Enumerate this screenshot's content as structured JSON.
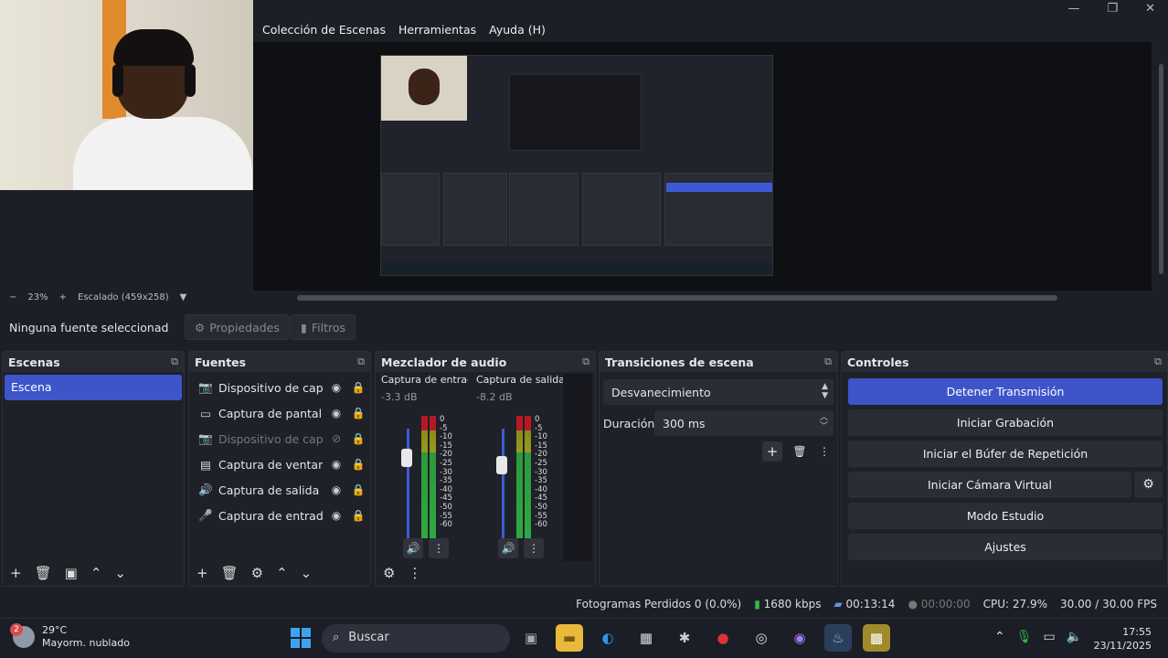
{
  "menu": [
    "Colección de Escenas",
    "Herramientas",
    "Ayuda (H)"
  ],
  "window_controls": [
    "—",
    "❐",
    "✕"
  ],
  "preview": {
    "zoom_minus": "−",
    "zoom": "23%",
    "zoom_plus": "+",
    "scale_label": "Escalado (459x258)"
  },
  "source_toolbar": {
    "no_source": "Ninguna fuente seleccionad",
    "properties": "Propiedades",
    "filters": "Filtros"
  },
  "scenes": {
    "title": "Escenas",
    "items": [
      "Escena"
    ]
  },
  "sources": {
    "title": "Fuentes",
    "items": [
      {
        "label": "Dispositivo de captu",
        "icon": "camera-icon",
        "visible": true
      },
      {
        "label": "Captura de pantalla :",
        "icon": "monitor-icon",
        "visible": true
      },
      {
        "label": "Dispositivo de captu",
        "icon": "camera-icon",
        "visible": false
      },
      {
        "label": "Captura de ventana",
        "icon": "window-icon",
        "visible": true
      },
      {
        "label": "Captura de salida de",
        "icon": "speaker-icon",
        "visible": true
      },
      {
        "label": "Captura de entrada d",
        "icon": "microphone-icon",
        "visible": true
      }
    ]
  },
  "mixer": {
    "title": "Mezclador de audio",
    "channels": [
      {
        "name": "Captura de entrada",
        "db": "-3.3 dB",
        "level": 0.78
      },
      {
        "name": "Captura de salida c",
        "db": "-8.2 dB",
        "level": 0.7
      }
    ],
    "ticks": [
      "0",
      "-5",
      "-10",
      "-15",
      "-20",
      "-25",
      "-30",
      "-35",
      "-40",
      "-45",
      "-50",
      "-55",
      "-60"
    ]
  },
  "transitions": {
    "title": "Transiciones de escena",
    "selected": "Desvanecimiento",
    "duration_label": "Duración",
    "duration_value": "300 ms"
  },
  "controls": {
    "title": "Controles",
    "buttons": [
      "Detener Transmisión",
      "Iniciar Grabación",
      "Iniciar el Búfer de Repetición",
      "Iniciar Cámara Virtual",
      "Modo Estudio",
      "Ajustes"
    ]
  },
  "status": {
    "dropped": "Fotogramas Perdidos 0 (0.0%)",
    "bitrate": "1680 kbps",
    "stream_time": "00:13:14",
    "rec_time": "00:00:00",
    "cpu": "CPU: 27.9%",
    "fps": "30.00 / 30.00 FPS"
  },
  "taskbar": {
    "weather_badge": "2",
    "temp": "29°C",
    "weather": "Mayorm. nublado",
    "search": "Buscar",
    "time": "17:55",
    "date": "23/11/2025"
  },
  "colors": {
    "accent": "#3d55c9",
    "panel": "#1f2128",
    "background": "#1d1f26"
  }
}
